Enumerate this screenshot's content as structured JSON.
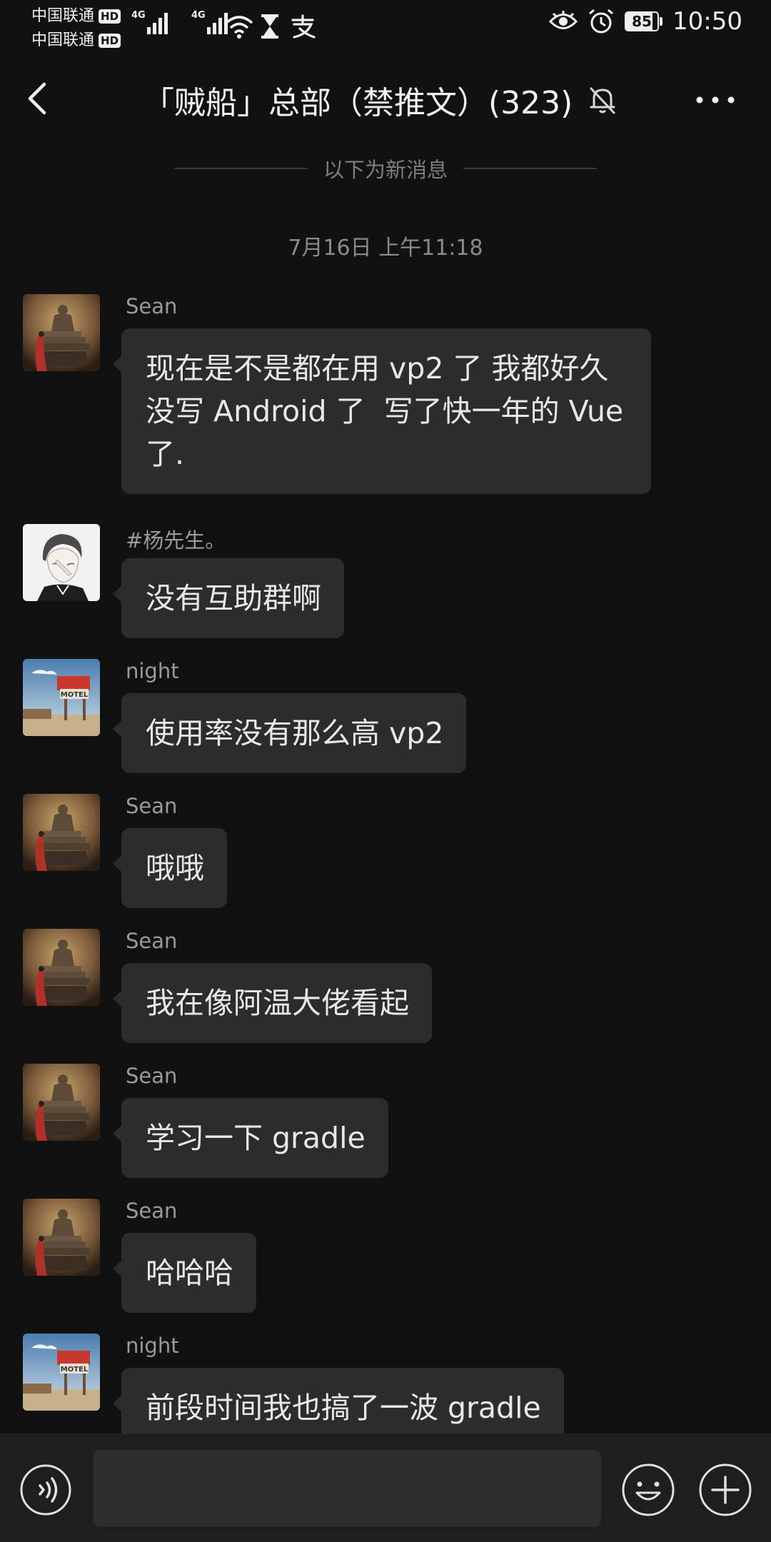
{
  "status_bar": {
    "carrier_1": "中国联通",
    "carrier_2": "中国联通",
    "hd_badge": "HD",
    "network_1": "4G",
    "network_2": "4G",
    "battery_text": "85",
    "battery_level": 0.85,
    "time": "10:50",
    "icons": [
      "signal-icon",
      "wifi-icon",
      "hourglass-icon",
      "alipay-icon",
      "eye-icon",
      "alarm-icon",
      "battery-icon"
    ]
  },
  "header": {
    "title": "「贼船」总部（禁推文）(323)",
    "back_icon": "chevron-left-icon",
    "mute_icon": "bell-muted-icon",
    "more_icon": "more-dots-icon"
  },
  "divider_text": "以下为新消息",
  "timestamp": "7月16日 上午11:18",
  "avatar_types": {
    "Sean": "buddha",
    "night": "motel",
    "#杨先生。": "sketch"
  },
  "messages": [
    {
      "sender": "Sean",
      "text": "现在是不是都在用 vp2 了 我都好久\n没写 Android 了  写了快一年的 Vue\n了."
    },
    {
      "sender": "#杨先生。",
      "text": "没有互助群啊"
    },
    {
      "sender": "night",
      "text": "使用率没有那么高 vp2"
    },
    {
      "sender": "Sean",
      "text": "哦哦"
    },
    {
      "sender": "Sean",
      "text": "我在像阿温大佬看起"
    },
    {
      "sender": "Sean",
      "text": "学习一下 gradle"
    },
    {
      "sender": "Sean",
      "text": "哈哈哈"
    },
    {
      "sender": "night",
      "text": "前段时间我也搞了一波 gradle"
    }
  ],
  "input_bar": {
    "voice_icon": "voice-icon",
    "input_value": "",
    "emoji_icon": "emoji-icon",
    "plus_icon": "plus-icon"
  },
  "colors": {
    "background": "#111111",
    "bubble": "#2c2c2c",
    "sender_name": "#9a9a9a",
    "text": "#e8e8e8"
  }
}
